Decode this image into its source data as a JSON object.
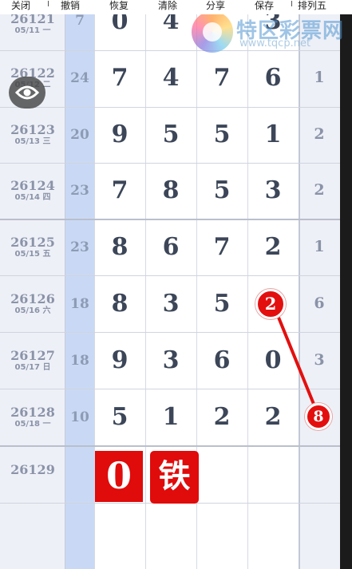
{
  "toolbar": {
    "close_label": "关闭",
    "undo_label": "撤销",
    "redo_label": "恢复",
    "clear_label": "清除",
    "share_label": "分享",
    "save_label": "保存",
    "rank_label": "排列五"
  },
  "watermark": {
    "name": "特区彩票网",
    "url": "www.tqcp.net"
  },
  "colors": {
    "accent_red": "#e00b0b",
    "sum_column": "#c9d9f5",
    "digit_text": "#3c4658",
    "muted_text": "#8a93a8"
  },
  "rows": [
    {
      "issue": "26121",
      "date": "05/11 一",
      "sum": "7",
      "d1": "0",
      "d2": "4",
      "d3": "",
      "d4": "3",
      "span": ""
    },
    {
      "issue": "26122",
      "date": "05/12 二",
      "sum": "24",
      "d1": "7",
      "d2": "4",
      "d3": "7",
      "d4": "6",
      "span": "1"
    },
    {
      "issue": "26123",
      "date": "05/13 三",
      "sum": "20",
      "d1": "9",
      "d2": "5",
      "d3": "5",
      "d4": "1",
      "span": "2"
    },
    {
      "issue": "26124",
      "date": "05/14 四",
      "sum": "23",
      "d1": "7",
      "d2": "8",
      "d3": "5",
      "d4": "3",
      "span": "2"
    },
    {
      "issue": "26125",
      "date": "05/15 五",
      "sum": "23",
      "d1": "8",
      "d2": "6",
      "d3": "7",
      "d4": "2",
      "span": "1"
    },
    {
      "issue": "26126",
      "date": "05/16 六",
      "sum": "18",
      "d1": "8",
      "d2": "3",
      "d3": "5",
      "d4": "",
      "span": "6"
    },
    {
      "issue": "26127",
      "date": "05/17 日",
      "sum": "18",
      "d1": "9",
      "d2": "3",
      "d3": "6",
      "d4": "0",
      "span": "3"
    },
    {
      "issue": "26128",
      "date": "05/18 一",
      "sum": "10",
      "d1": "5",
      "d2": "1",
      "d3": "2",
      "d4": "2",
      "span": ""
    }
  ],
  "next_issue": "26129",
  "marks": {
    "circle_a": "2",
    "circle_b": "8",
    "pick_digit": "0",
    "pick_char": "铁"
  },
  "icons": {
    "visibility": "eye-icon"
  }
}
